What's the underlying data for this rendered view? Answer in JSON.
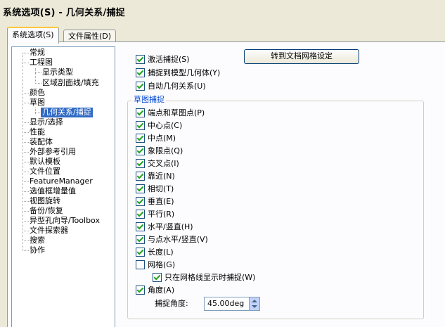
{
  "window": {
    "title": "系统选项(S) - 几何关系/捕捉"
  },
  "tabs": [
    {
      "label": "系统选项(S)",
      "active": true
    },
    {
      "label": "文件属性(D)",
      "active": false
    }
  ],
  "tree": {
    "items": [
      {
        "label": "常规"
      },
      {
        "label": "工程图"
      },
      {
        "label": "显示类型"
      },
      {
        "label": "区域剖面线/填充"
      },
      {
        "label": "颜色"
      },
      {
        "label": "草图"
      },
      {
        "label": "几何关系/捕捉",
        "selected": true
      },
      {
        "label": "显示/选择"
      },
      {
        "label": "性能"
      },
      {
        "label": "装配体"
      },
      {
        "label": "外部参考引用"
      },
      {
        "label": "默认模板"
      },
      {
        "label": "文件位置"
      },
      {
        "label": "FeatureManager"
      },
      {
        "label": "选值框增量值"
      },
      {
        "label": "视图旋转"
      },
      {
        "label": "备份/恢复"
      },
      {
        "label": "异型孔向导/Toolbox"
      },
      {
        "label": "文件探索器"
      },
      {
        "label": "搜索"
      },
      {
        "label": "协作"
      }
    ]
  },
  "main": {
    "top_options": [
      {
        "label": "激活捕捉(S)",
        "checked": true
      },
      {
        "label": "捕捉到模型几何体(Y)",
        "checked": true
      },
      {
        "label": "自动几何关系(U)",
        "checked": true
      }
    ],
    "grid_button": "转到文档网格设定",
    "group": {
      "title": "草图捕捉",
      "options": [
        {
          "label": "端点和草图点(P)",
          "checked": true
        },
        {
          "label": "中心点(C)",
          "checked": true
        },
        {
          "label": "中点(M)",
          "checked": true
        },
        {
          "label": "象限点(Q)",
          "checked": true
        },
        {
          "label": "交叉点(I)",
          "checked": true
        },
        {
          "label": "靠近(N)",
          "checked": true
        },
        {
          "label": "相切(T)",
          "checked": true
        },
        {
          "label": "垂直(E)",
          "checked": true
        },
        {
          "label": "平行(R)",
          "checked": true
        },
        {
          "label": "水平/竖直(H)",
          "checked": true
        },
        {
          "label": "与点水平/竖直(V)",
          "checked": true
        },
        {
          "label": "长度(L)",
          "checked": true
        },
        {
          "label": "网格(G)",
          "checked": false
        },
        {
          "label": "只在网格线显示时捕捉(W)",
          "checked": true
        },
        {
          "label": "角度(A)",
          "checked": true
        }
      ],
      "snap_angle_label": "捕捉角度:",
      "snap_angle_value": "45.00deg"
    }
  }
}
